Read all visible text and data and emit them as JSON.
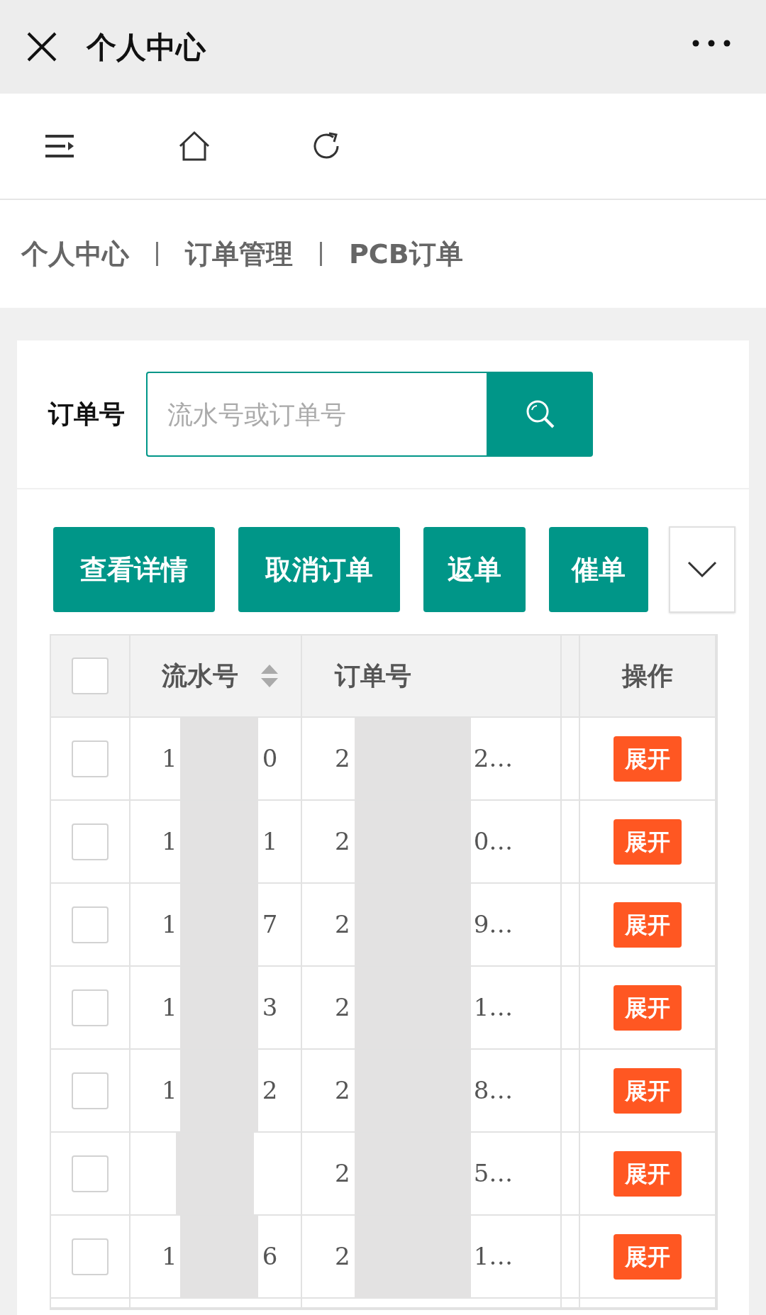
{
  "window": {
    "title": "个人中心"
  },
  "breadcrumb": [
    "个人中心",
    "订单管理",
    "PCB订单"
  ],
  "search": {
    "label": "订单号",
    "placeholder": "流水号或订单号"
  },
  "actions": [
    "查看详情",
    "取消订单",
    "返单",
    "催单"
  ],
  "table": {
    "all_selected": false,
    "columns": [
      "流水号",
      "订单号",
      "操作"
    ],
    "rows": [
      {
        "selected": false,
        "serial_start": "1",
        "serial_end": "0",
        "order_start": "2",
        "order_end": "2…",
        "action": "展开"
      },
      {
        "selected": false,
        "serial_start": "1",
        "serial_end": "1",
        "order_start": "2",
        "order_end": "0…",
        "action": "展开"
      },
      {
        "selected": false,
        "serial_start": "1",
        "serial_end": "7",
        "order_start": "2",
        "order_end": "9…",
        "action": "展开"
      },
      {
        "selected": false,
        "serial_start": "1",
        "serial_end": "3",
        "order_start": "2",
        "order_end": "1…",
        "action": "展开"
      },
      {
        "selected": false,
        "serial_start": "1",
        "serial_end": "2",
        "order_start": "2",
        "order_end": "8…",
        "action": "展开"
      },
      {
        "selected": false,
        "order_start": "2",
        "order_end": "5…",
        "action": "展开"
      },
      {
        "selected": false,
        "serial_start": "1",
        "serial_end": "6",
        "order_start": "2",
        "order_end": "1…",
        "action": "展开"
      }
    ]
  }
}
